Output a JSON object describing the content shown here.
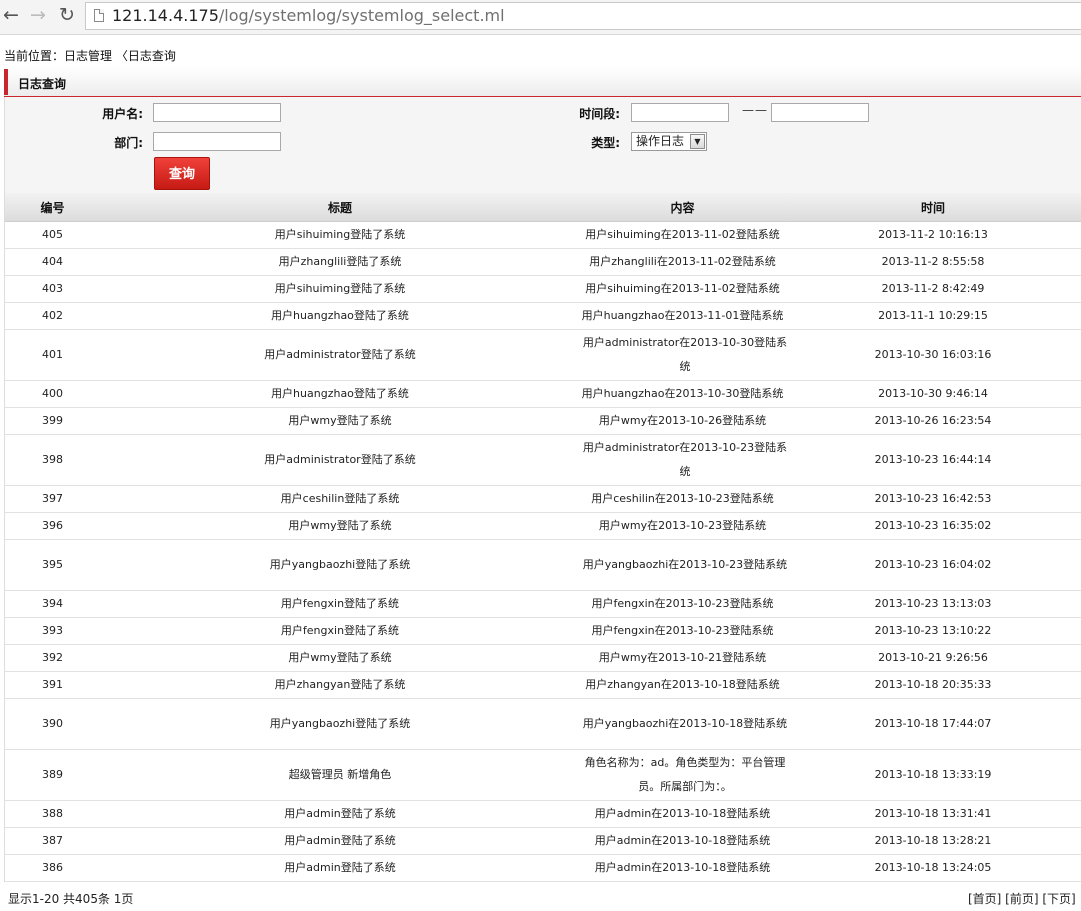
{
  "browser": {
    "url_host": "121.14.4.175",
    "url_path": "/log/systemlog/systemlog_select.ml"
  },
  "breadcrumb": "当前位置：日志管理 〈日志查询",
  "section_title": "日志查询",
  "form": {
    "username_label": "用户名:",
    "department_label": "部门:",
    "time_label": "时间段:",
    "time_separator": "——",
    "type_label": "类型:",
    "type_selected": "操作日志",
    "query_button": "查询"
  },
  "table": {
    "headers": [
      "编号",
      "标题",
      "内容",
      "时间"
    ],
    "rows": [
      {
        "id": "405",
        "title": "用户sihuiming登陆了系统",
        "content": "用户sihuiming在2013-11-02登陆系统",
        "time": "2013-11-2 10:16:13"
      },
      {
        "id": "404",
        "title": "用户zhanglili登陆了系统",
        "content": "用户zhanglili在2013-11-02登陆系统",
        "time": "2013-11-2 8:55:58"
      },
      {
        "id": "403",
        "title": "用户sihuiming登陆了系统",
        "content": "用户sihuiming在2013-11-02登陆系统",
        "time": "2013-11-2 8:42:49"
      },
      {
        "id": "402",
        "title": "用户huangzhao登陆了系统",
        "content": "用户huangzhao在2013-11-01登陆系统",
        "time": "2013-11-1 10:29:15"
      },
      {
        "id": "401",
        "title": "用户administrator登陆了系统",
        "content": "用户administrator在2013-10-30登陆系统",
        "time": "2013-10-30 16:03:16"
      },
      {
        "id": "400",
        "title": "用户huangzhao登陆了系统",
        "content": "用户huangzhao在2013-10-30登陆系统",
        "time": "2013-10-30 9:46:14"
      },
      {
        "id": "399",
        "title": "用户wmy登陆了系统",
        "content": "用户wmy在2013-10-26登陆系统",
        "time": "2013-10-26 16:23:54"
      },
      {
        "id": "398",
        "title": "用户administrator登陆了系统",
        "content": "用户administrator在2013-10-23登陆系统",
        "time": "2013-10-23 16:44:14"
      },
      {
        "id": "397",
        "title": "用户ceshilin登陆了系统",
        "content": "用户ceshilin在2013-10-23登陆系统",
        "time": "2013-10-23 16:42:53"
      },
      {
        "id": "396",
        "title": "用户wmy登陆了系统",
        "content": "用户wmy在2013-10-23登陆系统",
        "time": "2013-10-23 16:35:02"
      },
      {
        "id": "395",
        "title": "用户yangbaozhi登陆了系统",
        "content": "用户yangbaozhi在2013-10-23登陆系统",
        "time": "2013-10-23 16:04:02"
      },
      {
        "id": "394",
        "title": "用户fengxin登陆了系统",
        "content": "用户fengxin在2013-10-23登陆系统",
        "time": "2013-10-23 13:13:03"
      },
      {
        "id": "393",
        "title": "用户fengxin登陆了系统",
        "content": "用户fengxin在2013-10-23登陆系统",
        "time": "2013-10-23 13:10:22"
      },
      {
        "id": "392",
        "title": "用户wmy登陆了系统",
        "content": "用户wmy在2013-10-21登陆系统",
        "time": "2013-10-21 9:26:56"
      },
      {
        "id": "391",
        "title": "用户zhangyan登陆了系统",
        "content": "用户zhangyan在2013-10-18登陆系统",
        "time": "2013-10-18 20:35:33"
      },
      {
        "id": "390",
        "title": "用户yangbaozhi登陆了系统",
        "content": "用户yangbaozhi在2013-10-18登陆系统",
        "time": "2013-10-18 17:44:07"
      },
      {
        "id": "389",
        "title": "超级管理员 新增角色",
        "content": "角色名称为：ad。角色类型为：平台管理员。所属部门为：。",
        "time": "2013-10-18 13:33:19"
      },
      {
        "id": "388",
        "title": "用户admin登陆了系统",
        "content": "用户admin在2013-10-18登陆系统",
        "time": "2013-10-18 13:31:41"
      },
      {
        "id": "387",
        "title": "用户admin登陆了系统",
        "content": "用户admin在2013-10-18登陆系统",
        "time": "2013-10-18 13:28:21"
      },
      {
        "id": "386",
        "title": "用户admin登陆了系统",
        "content": "用户admin在2013-10-18登陆系统",
        "time": "2013-10-18 13:24:05"
      }
    ]
  },
  "footer": {
    "summary": "显示1-20 共405条 1页",
    "pager": "[首页] [前页] [下页]"
  },
  "icons": {
    "back": "back-arrow-icon",
    "forward": "forward-arrow-icon",
    "reload": "reload-icon",
    "page": "page-icon",
    "dropdown": "chevron-down-icon"
  },
  "colors": {
    "accent_red": "#c8272d",
    "button_red": "#e0302a"
  }
}
